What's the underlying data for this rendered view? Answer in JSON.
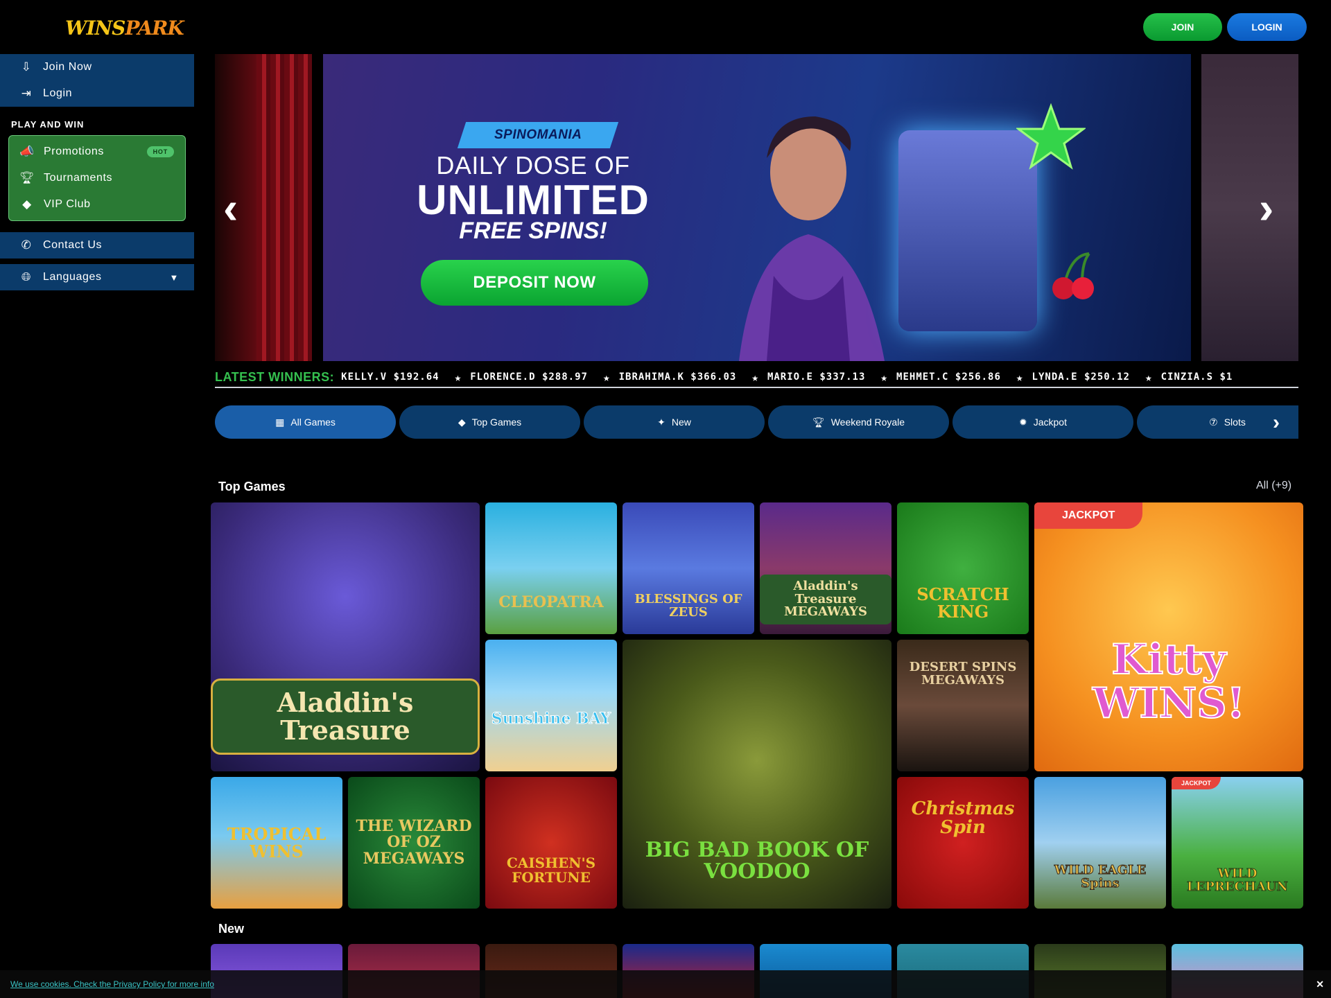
{
  "header": {
    "logo": {
      "part1": "WINS",
      "part2": "PARK"
    },
    "join_label": "JOIN",
    "login_label": "LOGIN"
  },
  "sidebar": {
    "top_items": [
      {
        "label": "Join Now",
        "icon": "join-icon"
      },
      {
        "label": "Login",
        "icon": "login-icon"
      }
    ],
    "section_heading": "PLAY AND WIN",
    "play_items": [
      {
        "label": "Promotions",
        "icon": "megaphone-icon",
        "badge": "HOT"
      },
      {
        "label": "Tournaments",
        "icon": "trophy-icon"
      },
      {
        "label": "VIP Club",
        "icon": "diamond-icon"
      }
    ],
    "contact_label": "Contact Us",
    "languages_label": "Languages"
  },
  "banner": {
    "tag": "SPINOMANIA",
    "line1": "DAILY DOSE OF",
    "line2": "UNLIMITED",
    "line3": "FREE SPINS!",
    "cta": "DEPOSIT NOW"
  },
  "winners": {
    "label": "LATEST WINNERS:",
    "entries": [
      "KELLY.V $192.64",
      "FLORENCE.D $288.97",
      "IBRAHIMA.K $366.03",
      "MARIO.E $337.13",
      "MEHMET.C $256.86",
      "LYNDA.E $250.12",
      "CINZIA.S $1"
    ]
  },
  "tabs": [
    {
      "label": "All Games",
      "icon": "grid-icon"
    },
    {
      "label": "Top Games",
      "icon": "diamond-icon"
    },
    {
      "label": "New",
      "icon": "sparkle-icon"
    },
    {
      "label": "Weekend Royale",
      "icon": "trophy-icon"
    },
    {
      "label": "Jackpot",
      "icon": "gear-icon"
    },
    {
      "label": "Slots",
      "icon": "slots-777-icon"
    }
  ],
  "top_games": {
    "title": "Top Games",
    "all_label": "All (+9)",
    "games": [
      {
        "name": "Aladdin's Treasure"
      },
      {
        "name": "CLEOPATRA"
      },
      {
        "name": "BLESSINGS OF ZEUS"
      },
      {
        "name": "Aladdin's Treasure MEGAWAYS"
      },
      {
        "name": "SCRATCH KING"
      },
      {
        "name": "Kitty WINS!",
        "badge": "JACKPOT"
      },
      {
        "name": "Sunshine BAY"
      },
      {
        "name": "BIG BAD BOOK OF VOODOO"
      },
      {
        "name": "DESERT SPINS MEGAWAYS"
      },
      {
        "name": "TROPICAL WINS"
      },
      {
        "name": "THE WIZARD OF OZ MEGAWAYS"
      },
      {
        "name": "CAISHEN'S FORTUNE"
      },
      {
        "name": "Christmas Spin"
      },
      {
        "name": "WILD EAGLE Spins"
      },
      {
        "name": "WILD LEPRECHAUN",
        "badge": "JACKPOT"
      }
    ]
  },
  "new_section": {
    "title": "New"
  },
  "cookie": {
    "text": "We use cookies. Check the Privacy Policy for more info",
    "close": "✕"
  }
}
